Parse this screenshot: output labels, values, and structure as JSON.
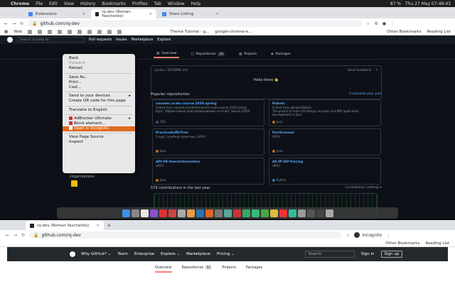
{
  "mac_menu": {
    "apple": "",
    "items": [
      "Chrome",
      "File",
      "Edit",
      "View",
      "History",
      "Bookmarks",
      "Profiles",
      "Tab",
      "Window",
      "Help"
    ],
    "status": [
      "87 %",
      "Thu 27 May 07:49:43"
    ]
  },
  "browser_top": {
    "tabs": [
      {
        "label": "Extensions",
        "active": false
      },
      {
        "label": "rq-dev (Roman Yaschenko)",
        "active": true
      },
      {
        "label": "Store Listing",
        "active": false
      }
    ],
    "url": "github.com/rq-dev",
    "bookmarks": [
      "Web",
      "Theme Tutorial - g...",
      "google-chrome-e...",
      "Other Bookmarks",
      "Reading List"
    ]
  },
  "github_top": {
    "search_placeholder": "Search or jump to...",
    "nav": [
      "Pull requests",
      "Issues",
      "Marketplace",
      "Explore"
    ],
    "tabs": [
      {
        "label": "Overview",
        "count": "",
        "selected": true
      },
      {
        "label": "Repositories",
        "count": "34",
        "selected": false
      },
      {
        "label": "Projects",
        "count": "",
        "selected": false
      },
      {
        "label": "Packages",
        "count": "",
        "selected": false
      }
    ],
    "readme_path": "rq-dev / README.md",
    "send_feedback": "Send feedback",
    "hello": "Hello there 👋",
    "popular_title": "Popular repositories",
    "customize": "Customize your pins",
    "repos": [
      {
        "name": "naumen.scala.course.2020.spring",
        "desc": "Forked from naumen-student/naumen.scala.course.2020.spring",
        "desc2": "Курс \"Эффективное программирование на Scala\" (весна 2020)",
        "lang": "CSS",
        "color": "#563d7c"
      },
      {
        "name": "Robots",
        "desc": "Forked from ablopin/Robots",
        "desc2": "The project to learn OO design concepts and MDI application development in Java",
        "lang": "Java",
        "color": "#b07219"
      },
      {
        "name": "PracticeSuffixTree",
        "desc": "3 курс | учебная практика | URFU",
        "desc2": "",
        "lang": "Java",
        "color": "#b07219"
      },
      {
        "name": "PortScanner",
        "desc": "URFU",
        "desc2": "",
        "lang": "Java",
        "color": "#b07219"
      },
      {
        "name": "API-VK-UsersInformation",
        "desc": "URFU",
        "desc2": "",
        "lang": "Java",
        "color": "#b07219"
      },
      {
        "name": "AS-IP-ISP-Tracing",
        "desc": "URFU",
        "desc2": "",
        "lang": "Python",
        "color": "#3572A5"
      }
    ],
    "contrib_title": "579 contributions in the last year",
    "contrib_settings": "Contribution settings ▾",
    "organizations": "Organizations"
  },
  "context_menu": {
    "groups": [
      [
        {
          "label": "Back",
          "dim": false
        },
        {
          "label": "Forward",
          "dim": true
        },
        {
          "label": "Reload",
          "dim": false
        }
      ],
      [
        {
          "label": "Save As...",
          "dim": false
        },
        {
          "label": "Print...",
          "dim": false
        },
        {
          "label": "Cast...",
          "dim": false
        }
      ],
      [
        {
          "label": "Send to your devices",
          "dim": false,
          "arrow": true
        },
        {
          "label": "Create QR code for this page",
          "dim": false
        }
      ],
      [
        {
          "label": "Translate to English",
          "dim": false
        }
      ],
      [
        {
          "label": "AdBlocker Ultimate",
          "dim": false,
          "arrow": true,
          "icon": true
        },
        {
          "label": "Block element...",
          "dim": false,
          "icon": true
        },
        {
          "label": "Open in Incognito",
          "dim": false,
          "icon": true,
          "highlight": true
        }
      ],
      [
        {
          "label": "View Page Source",
          "dim": false
        },
        {
          "label": "Inspect",
          "dim": false
        }
      ]
    ]
  },
  "dock": {
    "colors": [
      "#3d8ee8",
      "#888",
      "#e6e6e6",
      "#8a4fd1",
      "#d33",
      "#c44",
      "#aaa",
      "#e94",
      "#27b",
      "#d62",
      "#777",
      "#5a9",
      "#c33",
      "#3a6",
      "#3b7",
      "#4a4",
      "#e5b93d",
      "#e33",
      "#3b9",
      "#999",
      "#555",
      "#444",
      "#aaa"
    ]
  },
  "browser_bottom": {
    "tab_label": "rq-dev (Roman Yaschenko)",
    "url": "github.com/rq-dev",
    "bookmarks": [
      "Other Bookmarks",
      "Reading List"
    ],
    "incognito": "Incognito",
    "nav": [
      "Why GitHub? ⌄",
      "Team",
      "Enterprise",
      "Explore ⌄",
      "Marketplace",
      "Pricing ⌄"
    ],
    "search": "Search",
    "sign_in": "Sign in",
    "sign_up": "Sign up",
    "tabs": [
      {
        "label": "Overview"
      },
      {
        "label": "Repositories",
        "count": "32"
      },
      {
        "label": "Projects"
      },
      {
        "label": "Packages"
      }
    ]
  }
}
